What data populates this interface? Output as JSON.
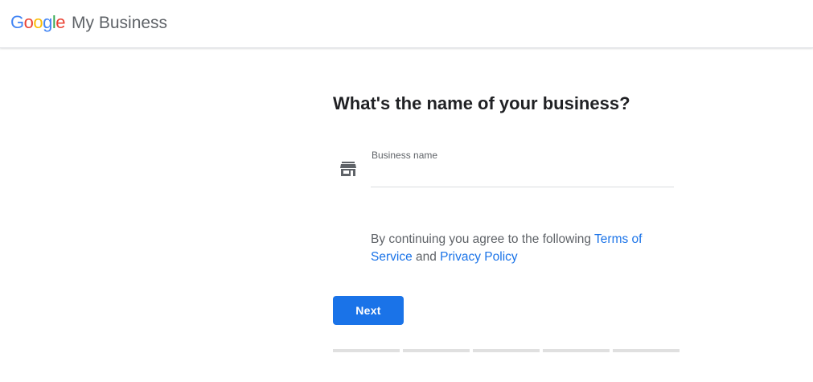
{
  "header": {
    "logo_letters": [
      {
        "char": "G",
        "color": "#4285F4"
      },
      {
        "char": "o",
        "color": "#EA4335"
      },
      {
        "char": "o",
        "color": "#FBBC05"
      },
      {
        "char": "g",
        "color": "#4285F4"
      },
      {
        "char": "l",
        "color": "#34A853"
      },
      {
        "char": "e",
        "color": "#EA4335"
      }
    ],
    "product_name": "My Business"
  },
  "main": {
    "title": "What's the name of your business?",
    "field": {
      "icon": "storefront-icon",
      "label": "Business name",
      "value": ""
    },
    "terms": {
      "prefix": "By continuing you agree to the following ",
      "terms_link": "Terms of Service",
      "middle": " and ",
      "privacy_link": "Privacy Policy"
    },
    "next_label": "Next",
    "progress": {
      "total_steps": 5,
      "current_step": 0
    }
  },
  "colors": {
    "primary": "#1a73e8",
    "text_secondary": "#5f6368",
    "divider": "#dadce0",
    "progress_inactive": "#e0e0e0"
  }
}
